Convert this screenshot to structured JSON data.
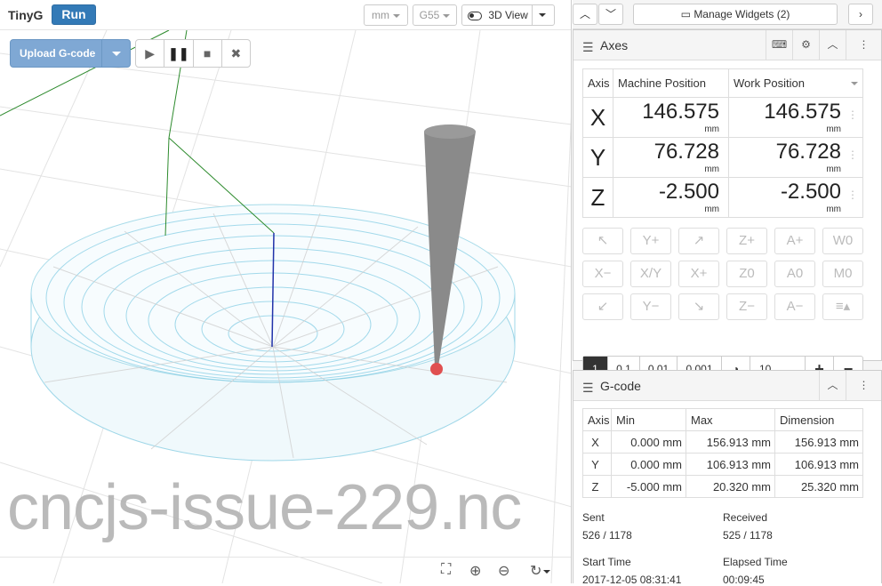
{
  "header": {
    "brand": "TinyG",
    "run_label": "Run",
    "units": "mm",
    "wcs": "G55",
    "view_label": "3D View"
  },
  "toolbar": {
    "upload_label": "Upload G-code"
  },
  "visualizer": {
    "filename": "cncjs-issue-229.nc"
  },
  "right_top": {
    "manage_label": "Manage Widgets (2)"
  },
  "axes_widget": {
    "title": "Axes",
    "columns": [
      "Axis",
      "Machine Position",
      "Work Position"
    ],
    "rows": [
      {
        "axis": "X",
        "machine": "146.575",
        "work": "146.575",
        "unit": "mm"
      },
      {
        "axis": "Y",
        "machine": "76.728",
        "work": "76.728",
        "unit": "mm"
      },
      {
        "axis": "Z",
        "machine": "-2.500",
        "work": "-2.500",
        "unit": "mm"
      }
    ],
    "jog_buttons": [
      [
        "↖",
        "Y+",
        "↗",
        "Z+",
        "A+",
        "W0"
      ],
      [
        "X−",
        "X/Y",
        "X+",
        "Z0",
        "A0",
        "M0"
      ],
      [
        "↙",
        "Y−",
        "↘",
        "Z−",
        "A−",
        "≡▴"
      ]
    ],
    "steps": [
      "1",
      "0.1",
      "0.01",
      "0.001"
    ],
    "custom_step": "10"
  },
  "gcode_widget": {
    "title": "G-code",
    "columns": [
      "Axis",
      "Min",
      "Max",
      "Dimension"
    ],
    "rows": [
      {
        "axis": "X",
        "min": "0.000 mm",
        "max": "156.913 mm",
        "dim": "156.913 mm"
      },
      {
        "axis": "Y",
        "min": "0.000 mm",
        "max": "106.913 mm",
        "dim": "106.913 mm"
      },
      {
        "axis": "Z",
        "min": "-5.000 mm",
        "max": "20.320 mm",
        "dim": "25.320 mm"
      }
    ],
    "sent_label": "Sent",
    "sent_value": "526 / 1178",
    "received_label": "Received",
    "received_value": "525 / 1178",
    "start_label": "Start Time",
    "start_value": "2017-12-05 08:31:41",
    "elapsed_label": "Elapsed Time",
    "elapsed_value": "00:09:45"
  }
}
